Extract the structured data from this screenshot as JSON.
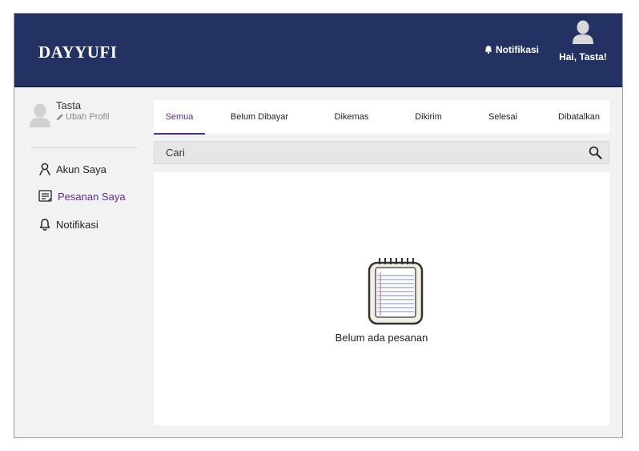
{
  "header": {
    "logo": "DAYYUFI",
    "notifications_label": "Notifikasi",
    "greeting": "Hai, Tasta!"
  },
  "sidebar": {
    "profile": {
      "name": "Tasta",
      "edit_label": "Ubah Profil"
    },
    "items": [
      {
        "label": "Akun Saya",
        "icon": "user-icon",
        "active": false
      },
      {
        "label": "Pesanan Saya",
        "icon": "order-list-icon",
        "active": true
      },
      {
        "label": "Notifikasi",
        "icon": "bell-icon",
        "active": false
      }
    ]
  },
  "tabs": [
    {
      "label": "Semua",
      "active": true
    },
    {
      "label": "Belum Dibayar",
      "active": false
    },
    {
      "label": "Dikemas",
      "active": false
    },
    {
      "label": "Dikirim",
      "active": false
    },
    {
      "label": "Selesai",
      "active": false
    },
    {
      "label": "Dibatalkan",
      "active": false
    }
  ],
  "search": {
    "placeholder": "Cari"
  },
  "empty_state": {
    "icon": "notepad-icon",
    "message": "Belum ada pesanan"
  },
  "colors": {
    "header_bg": "#233163",
    "accent": "#5a2a9a",
    "page_bg": "#f2f2f2"
  }
}
